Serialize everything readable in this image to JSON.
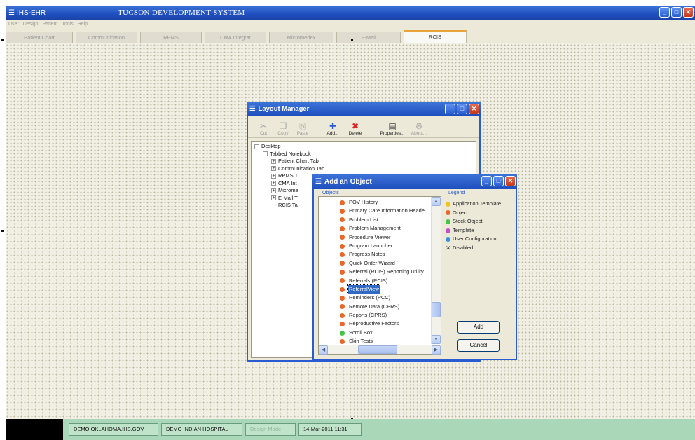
{
  "app": {
    "name": "IHS-EHR",
    "system_title": "TUCSON DEVELOPMENT SYSTEM"
  },
  "menu": [
    "User",
    "Design",
    "Patient",
    "Tools",
    "Help"
  ],
  "tabs": [
    {
      "label": "Patient Chart",
      "active": false
    },
    {
      "label": "Communication",
      "active": false
    },
    {
      "label": "RPMS",
      "active": false
    },
    {
      "label": "CMA Integrat",
      "active": false
    },
    {
      "label": "Micromedex",
      "active": false
    },
    {
      "label": "E-Mail",
      "active": false
    },
    {
      "label": "RCIS",
      "active": true
    }
  ],
  "status": {
    "server": "DEMO.OKLAHOMA.IHS.GOV",
    "facility": "DEMO INDIAN HOSPITAL",
    "mode": "Design Mode",
    "datetime": "14-Mar-2011 11:31"
  },
  "layout_manager": {
    "title": "Layout Manager",
    "toolbar": {
      "cut": "Cut",
      "copy": "Copy",
      "paste": "Paste",
      "add": "Add...",
      "delete": "Delete",
      "properties": "Properties...",
      "about": "About..."
    },
    "tree": [
      {
        "label": "Desktop",
        "level": 0,
        "expander": "−"
      },
      {
        "label": "Tabbed Notebook",
        "level": 1,
        "expander": "−"
      },
      {
        "label": "Patient Chart Tab",
        "level": 2,
        "expander": "+"
      },
      {
        "label": "Communication Tab",
        "level": 2,
        "expander": "+"
      },
      {
        "label": "RPMS T",
        "level": 2,
        "expander": "+"
      },
      {
        "label": "CMA Int",
        "level": 2,
        "expander": "+"
      },
      {
        "label": "Microme",
        "level": 2,
        "expander": "+"
      },
      {
        "label": "E-Mail T",
        "level": 2,
        "expander": "+"
      },
      {
        "label": "RCIS Ta",
        "level": 2,
        "expander": ""
      }
    ]
  },
  "add_object": {
    "title": "Add an Object",
    "objects_label": "Objects",
    "legend_label": "Legend",
    "objects": [
      {
        "label": "POV History",
        "type": "object",
        "selected": false
      },
      {
        "label": "Primary Care Information Heade",
        "type": "object",
        "selected": false
      },
      {
        "label": "Problem List",
        "type": "object",
        "selected": false
      },
      {
        "label": "Problem Management",
        "type": "object",
        "selected": false
      },
      {
        "label": "Procedure Viewer",
        "type": "object",
        "selected": false
      },
      {
        "label": "Program Launcher",
        "type": "object",
        "selected": false
      },
      {
        "label": "Progress Notes",
        "type": "object",
        "selected": false
      },
      {
        "label": "Quick Order Wizard",
        "type": "object",
        "selected": false
      },
      {
        "label": "Referral (RCIS) Reporting Utility",
        "type": "object",
        "selected": false
      },
      {
        "label": "Referrals (RCIS)",
        "type": "object",
        "selected": false
      },
      {
        "label": "ReferralView",
        "type": "object",
        "selected": true
      },
      {
        "label": "Reminders (PCC)",
        "type": "object",
        "selected": false
      },
      {
        "label": "Remote Data (CPRS)",
        "type": "object",
        "selected": false
      },
      {
        "label": "Reports (CPRS)",
        "type": "object",
        "selected": false
      },
      {
        "label": "Reproductive Factors",
        "type": "object",
        "selected": false
      },
      {
        "label": "Scroll Box",
        "type": "stock",
        "selected": false
      },
      {
        "label": "Skin Tests",
        "type": "object",
        "selected": false
      }
    ],
    "legend": [
      {
        "label": "Application Template",
        "color": "#f2c21d",
        "marker": "dot"
      },
      {
        "label": "Object",
        "color": "#e8672a",
        "marker": "dot"
      },
      {
        "label": "Stock Object",
        "color": "#47c447",
        "marker": "dot"
      },
      {
        "label": "Template",
        "color": "#c94fc9",
        "marker": "dot"
      },
      {
        "label": "User Configuration",
        "color": "#3a8ee0",
        "marker": "dot"
      },
      {
        "label": "Disabled",
        "color": "#333333",
        "marker": "x"
      }
    ],
    "add_button": "Add",
    "cancel_button": "Cancel"
  }
}
